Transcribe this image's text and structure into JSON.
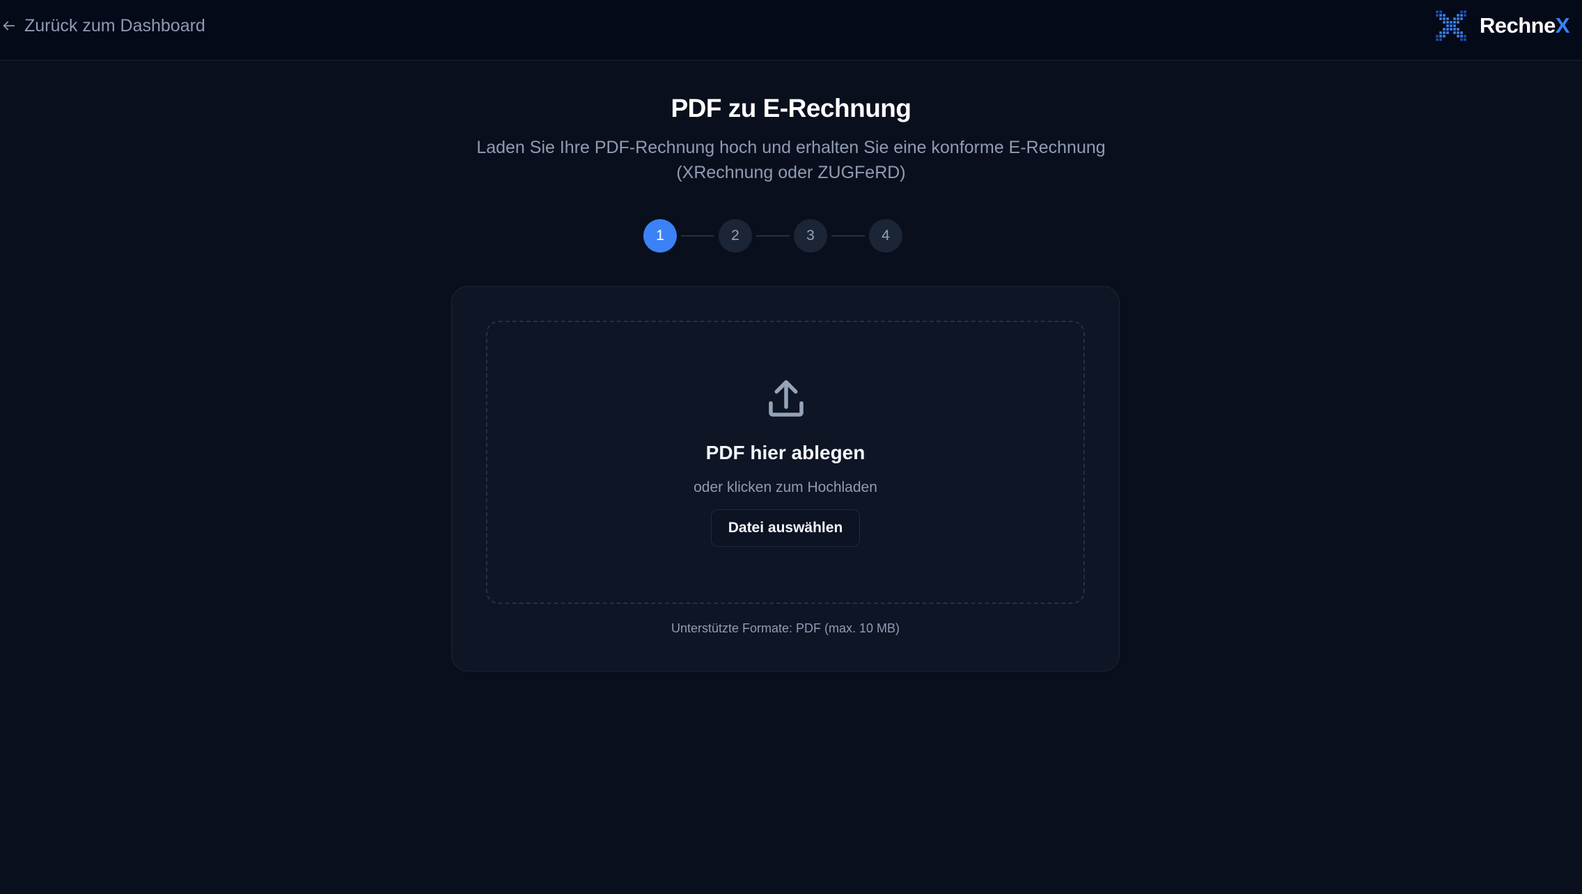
{
  "header": {
    "back_label": "Zurück zum Dashboard",
    "back_icon": "arrow-left-icon",
    "logo": {
      "text": "Rechne",
      "accent": "X",
      "icon": "x-grid-logo-icon"
    }
  },
  "page": {
    "title": "PDF zu E-Rechnung",
    "subtitle": "Laden Sie Ihre PDF-Rechnung hoch und erhalten Sie eine konforme E-Rechnung (XRechnung oder ZUGFeRD)"
  },
  "stepper": {
    "steps": [
      "1",
      "2",
      "3",
      "4"
    ],
    "current": "1"
  },
  "upload": {
    "icon": "upload-icon",
    "title": "PDF hier ablegen",
    "subtitle": "oder klicken zum Hochladen",
    "button_label": "Datei auswählen",
    "formats_note": "Unterstützte Formate: PDF (max. 10 MB)"
  },
  "colors": {
    "background": "#0a0f1d",
    "header_bg": "#050a18",
    "accent": "#3b82f6",
    "card_bg": "#0e1524",
    "muted_text": "#8f9cb3"
  }
}
